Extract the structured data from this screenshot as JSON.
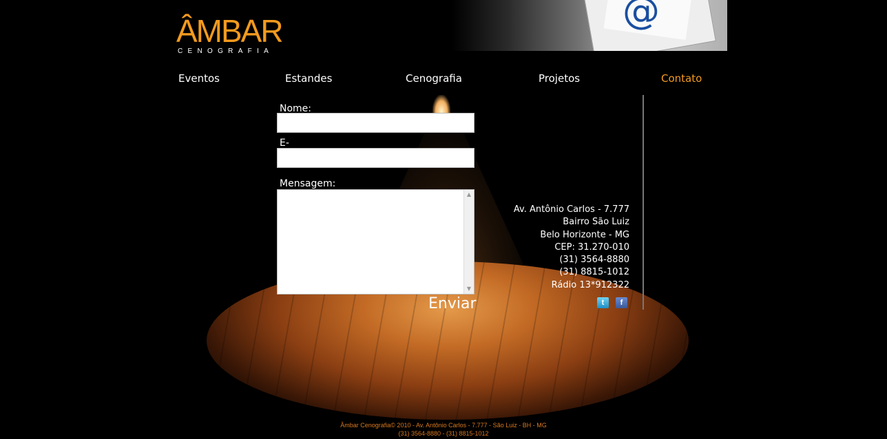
{
  "header": {
    "logo_main": "ÂMBAR",
    "logo_sub": "CENOGRAFIA",
    "header_image_icon": "envelope-at-icon"
  },
  "nav": {
    "items": [
      {
        "label": "Eventos"
      },
      {
        "label": "Estandes"
      },
      {
        "label": "Cenografia"
      },
      {
        "label": "Projetos"
      },
      {
        "label": "Contato"
      }
    ],
    "active": "Contato"
  },
  "form": {
    "name_label": "Nome:",
    "name_value": "",
    "email_label": "E-mail:",
    "email_value": "",
    "message_label": "Mensagem:",
    "message_value": "",
    "submit_label": "Enviar"
  },
  "address": {
    "street": "Av. Antônio Carlos - 7.777",
    "district": "Bairro São Luiz",
    "city": "Belo Horizonte - MG",
    "cep": "CEP: 31.270-010",
    "phone1": "(31)  3564-8880",
    "phone2": "(31)  8815-1012",
    "radio": "Rádio 13*912322"
  },
  "social": {
    "twitter_letter": "t",
    "facebook_letter": "f"
  },
  "footer": {
    "line1": "Âmbar Cenografia© 2010 - Av. Antônio Carlos - 7.777 - São Luiz - BH - MG",
    "line2": "(31)  3564-8880 - (31)  8815-1012"
  },
  "colors": {
    "accent": "#f39a1e",
    "background": "#000000",
    "footer_text": "#d9781c"
  }
}
